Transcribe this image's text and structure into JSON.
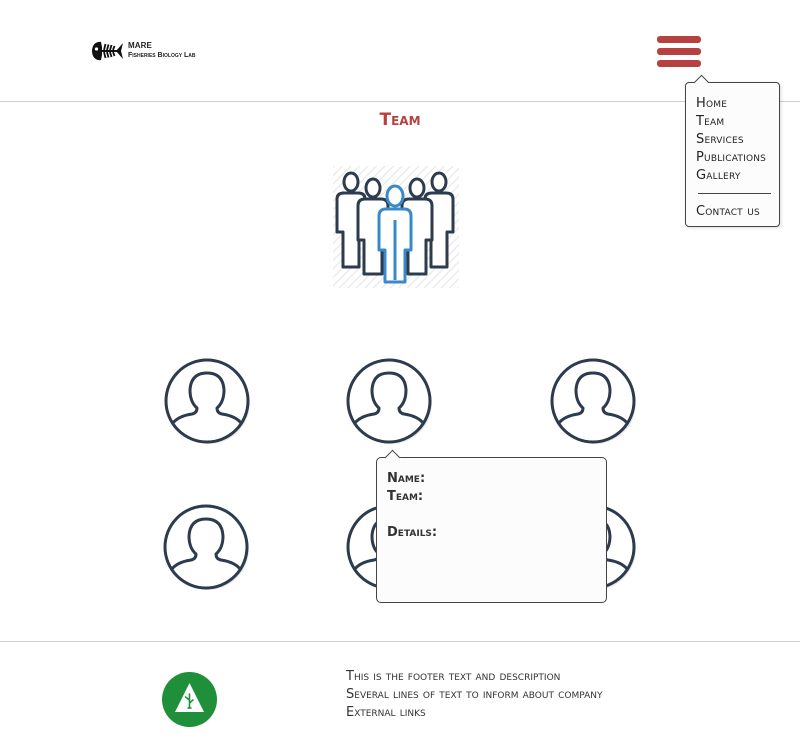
{
  "header": {
    "logo": {
      "title": "MARE",
      "subtitle": "Fisheries Biology Lab",
      "icon": "fish-skeleton-icon"
    },
    "menu_icon": "hamburger-menu-icon",
    "accent_color": "#b74141"
  },
  "menu": {
    "items": [
      {
        "label": "Home"
      },
      {
        "label": "Team"
      },
      {
        "label": "Services"
      },
      {
        "label": "Publications"
      },
      {
        "label": "Gallery"
      }
    ],
    "contact_label": "Contact us"
  },
  "main": {
    "title": "Team",
    "illustration": "team-group-icon",
    "members": [
      {
        "icon": "user-avatar-icon"
      },
      {
        "icon": "user-avatar-icon"
      },
      {
        "icon": "user-avatar-icon"
      },
      {
        "icon": "user-avatar-icon"
      },
      {
        "icon": "user-avatar-icon"
      },
      {
        "icon": "user-avatar-icon"
      }
    ],
    "popup": {
      "name_label": "Name:",
      "team_label": "Team:",
      "details_label": "Details:"
    }
  },
  "footer": {
    "logo_icon": "tree-icon",
    "logo_color": "#1f8f3a",
    "text_line": "This is the footer text and description",
    "info_line": "Several lines of text to inform about company",
    "link_label": "External links"
  }
}
